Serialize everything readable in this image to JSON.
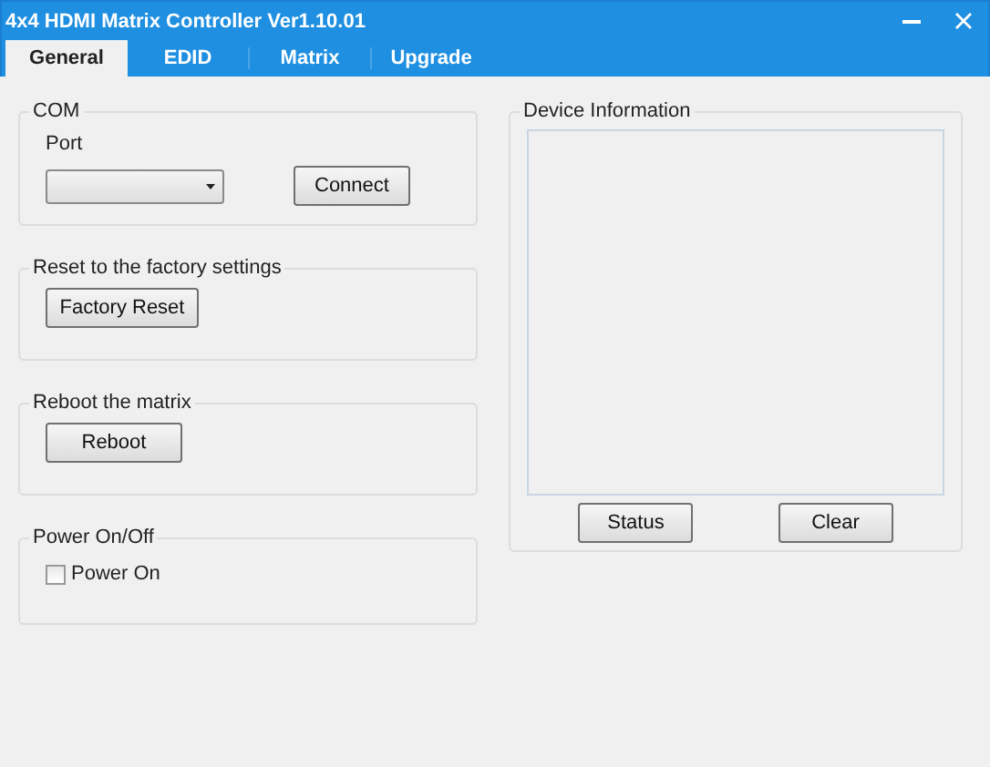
{
  "window": {
    "title": "4x4 HDMI Matrix Controller Ver1.10.01"
  },
  "tabs": [
    {
      "label": "General",
      "selected": true
    },
    {
      "label": "EDID",
      "selected": false
    },
    {
      "label": "Matrix",
      "selected": false
    },
    {
      "label": "Upgrade",
      "selected": false
    }
  ],
  "left_groups": [
    {
      "kind": "com",
      "title": "COM",
      "port_label": "Port",
      "button": "Connect"
    },
    {
      "kind": "button",
      "title": "Reset to the factory settings",
      "button": "Factory Reset"
    },
    {
      "kind": "button",
      "title": "Reboot the matrix",
      "button": "Reboot"
    },
    {
      "kind": "checkbox",
      "title": "Power On/Off",
      "checkbox": {
        "label": "Power On",
        "checked": false
      }
    }
  ],
  "device_info": {
    "title": "Device Information",
    "buttons": [
      "Status",
      "Clear"
    ]
  }
}
